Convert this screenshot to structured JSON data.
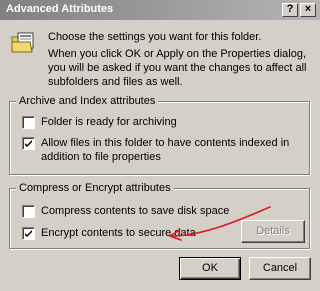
{
  "window": {
    "title": "Advanced Attributes",
    "help_glyph": "?",
    "close_glyph": "×"
  },
  "intro": {
    "line1": "Choose the settings you want for this folder.",
    "line2": "When you click OK or Apply on the Properties dialog, you will be asked if you want the changes to affect all subfolders and files as well."
  },
  "archive_group": {
    "title": "Archive and Index attributes",
    "items": [
      {
        "label": "Folder is ready for archiving",
        "checked": false
      },
      {
        "label": "Allow files in this folder to have contents indexed in addition to file properties",
        "checked": true
      }
    ]
  },
  "compress_group": {
    "title": "Compress or Encrypt attributes",
    "items": [
      {
        "label": "Compress contents to save disk space",
        "checked": false
      },
      {
        "label": "Encrypt contents to secure data",
        "checked": true
      }
    ],
    "details_label": "Details"
  },
  "buttons": {
    "ok": "OK",
    "cancel": "Cancel"
  },
  "colors": {
    "annotation": "#e0151b",
    "titlebar_inactive": "#808080",
    "face": "#d4d0c8"
  }
}
